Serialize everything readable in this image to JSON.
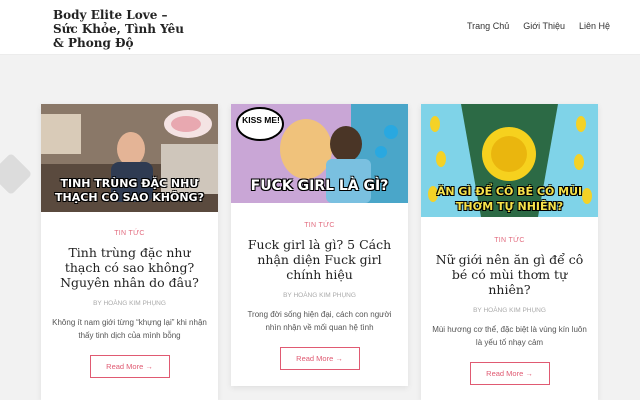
{
  "site": {
    "title": "Body Elite Love – Sức Khỏe, Tình Yêu & Phong Độ"
  },
  "nav": {
    "items": [
      "Trang Chủ",
      "Giới Thiệu",
      "Liên Hệ"
    ]
  },
  "posts": [
    {
      "image_caption": "TINH TRÙNG ĐẶC NHƯ THẠCH CÓ SAO KHÔNG?",
      "category": "TIN TỨC",
      "title": "Tinh trùng đặc như thạch có sao không? Nguyên nhân do đâu?",
      "by": "BY",
      "author": "Hoàng Kim Phụng",
      "excerpt": "Không ít nam giới từng “khựng lại” khi nhận thấy tinh dịch của mình bỗng",
      "read_more": "Read More →"
    },
    {
      "image_caption": "FUCK GIRL LÀ GÌ?",
      "image_badge": "KISS ME!",
      "category": "TIN TỨC",
      "title": "Fuck girl là gì? 5 Cách nhận diện Fuck girl chính hiệu",
      "by": "BY",
      "author": "Hoàng Kim Phụng",
      "excerpt": "Trong đời sống hiện đại, cách con người nhìn nhận về mối quan hệ tình",
      "read_more": "Read More →"
    },
    {
      "image_caption": "ĂN GÌ ĐỂ CÔ BÉ CÓ MÙI THƠM TỰ NHIÊN?",
      "category": "TIN TỨC",
      "title": "Nữ giới nên ăn gì để cô bé có mùi thơm tự nhiên?",
      "by": "BY",
      "author": "Hoàng Kim Phụng",
      "excerpt": "Mùi hương cơ thể, đặc biệt là vùng kín luôn là yếu tố nhạy cảm",
      "read_more": "Read More →"
    }
  ],
  "colors": {
    "accent": "#e05a72",
    "background": "#f2f2f2"
  }
}
